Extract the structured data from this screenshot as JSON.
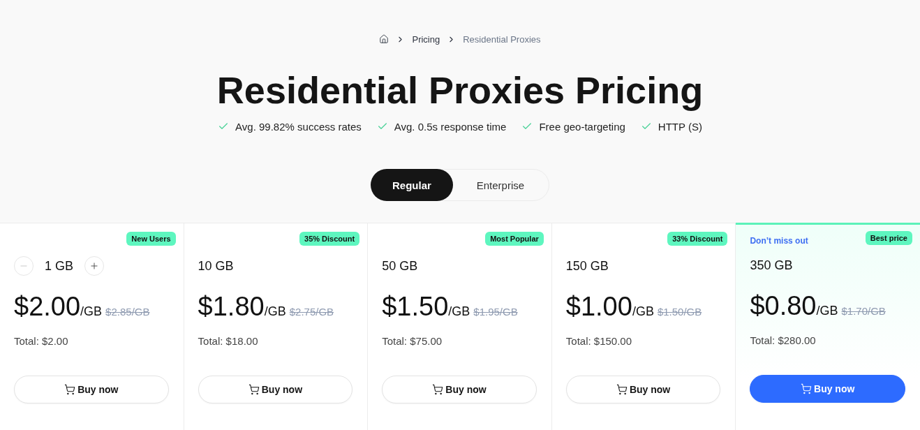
{
  "breadcrumb": [
    {
      "label": "Pricing",
      "current": false
    },
    {
      "label": "Residential Proxies",
      "current": true
    }
  ],
  "title": "Residential Proxies Pricing",
  "features": [
    "Avg. 99.82% success rates",
    "Avg. 0.5s response time",
    "Free geo-targeting",
    "HTTP (S)"
  ],
  "plan_toggle": [
    {
      "label": "Regular",
      "selected": true
    },
    {
      "label": "Enterprise",
      "selected": false
    }
  ],
  "plans": [
    {
      "kind": "stepper",
      "badge": "New Users",
      "size": "1 GB",
      "stepper": {
        "decrease_disabled": true,
        "increase_disabled": false
      },
      "price": "$2.00",
      "unit": "/GB",
      "old_price": "$2.85/GB",
      "total": "Total: $2.00",
      "button": "Buy now",
      "highlighted": false
    },
    {
      "kind": "fixed",
      "badge": "35% Discount",
      "size": "10 GB",
      "price": "$1.80",
      "unit": "/GB",
      "old_price": "$2.75/GB",
      "total": "Total: $18.00",
      "button": "Buy now",
      "highlighted": false
    },
    {
      "kind": "fixed",
      "badge": "Most Popular",
      "size": "50 GB",
      "price": "$1.50",
      "unit": "/GB",
      "old_price": "$1.95/GB",
      "total": "Total: $75.00",
      "button": "Buy now",
      "highlighted": false
    },
    {
      "kind": "fixed",
      "badge": "33% Discount",
      "size": "150 GB",
      "price": "$1.00",
      "unit": "/GB",
      "old_price": "$1.50/GB",
      "total": "Total: $150.00",
      "button": "Buy now",
      "highlighted": false
    },
    {
      "kind": "fixed",
      "note": "Don’t miss out",
      "badge": "Best price",
      "size": "350 GB",
      "price": "$0.80",
      "unit": "/GB",
      "old_price": "$1.70/GB",
      "total": "Total: $280.00",
      "button": "Buy now",
      "highlighted": true
    }
  ]
}
